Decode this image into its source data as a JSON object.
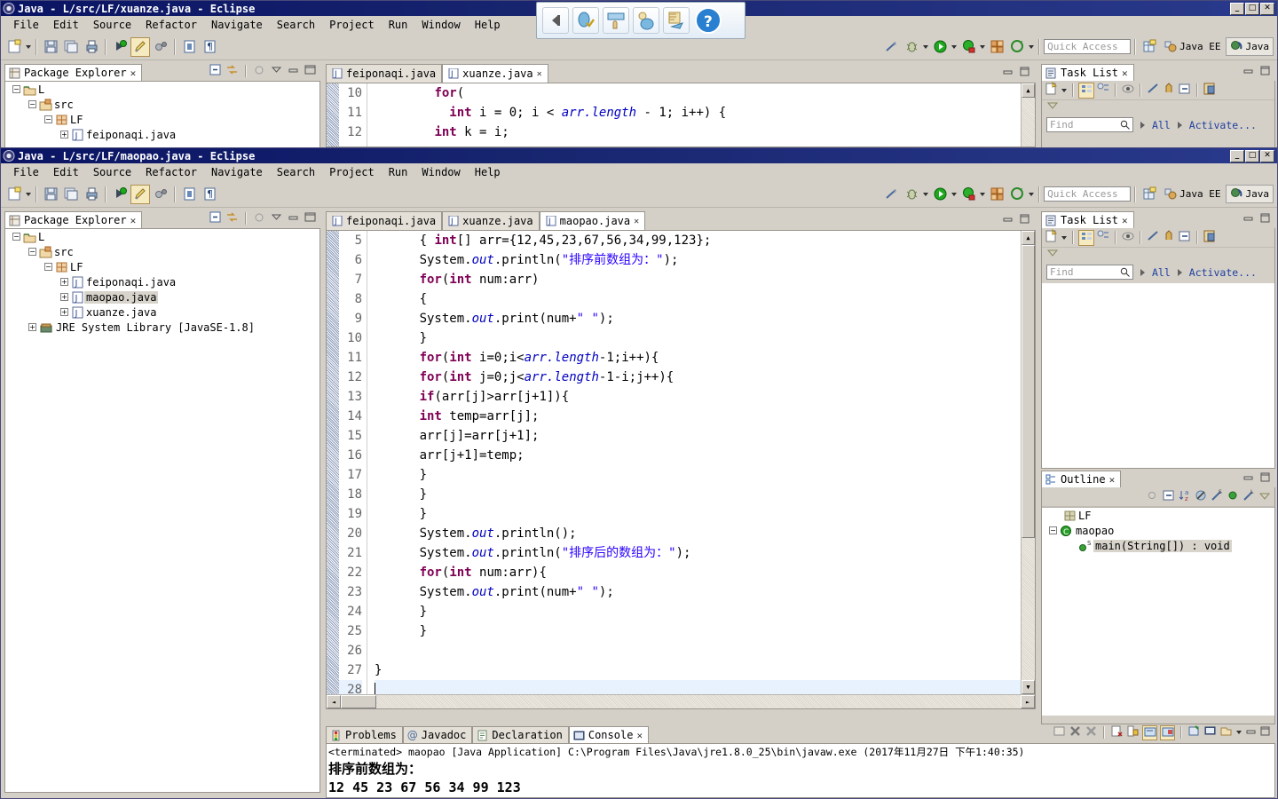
{
  "window_back": {
    "title": "Java - L/src/LF/xuanze.java - Eclipse",
    "menu": [
      "File",
      "Edit",
      "Source",
      "Refactor",
      "Navigate",
      "Search",
      "Project",
      "Run",
      "Window",
      "Help"
    ],
    "quick_access_placeholder": "Quick Access",
    "perspectives": [
      {
        "label": "Java EE"
      },
      {
        "label": "Java"
      }
    ],
    "explorer": {
      "tab_label": "Package Explorer",
      "tree": [
        {
          "label": "L",
          "indent": 0,
          "expander": "-",
          "icon": "project-folder-icon"
        },
        {
          "label": "src",
          "indent": 1,
          "expander": "-",
          "icon": "source-folder-icon"
        },
        {
          "label": "LF",
          "indent": 2,
          "expander": "-",
          "icon": "package-icon"
        },
        {
          "label": "feiponaqi.java",
          "indent": 3,
          "expander": "+",
          "icon": "java-file-icon"
        }
      ]
    },
    "editor": {
      "tabs": [
        {
          "label": "feiponaqi.java",
          "active": false,
          "closable": false
        },
        {
          "label": "xuanze.java",
          "active": true,
          "closable": true
        }
      ],
      "lines": [
        {
          "num": "10",
          "segments": [
            {
              "t": "        ",
              "c": ""
            },
            {
              "t": "for",
              "c": "kw"
            },
            {
              "t": "(",
              "c": ""
            }
          ]
        },
        {
          "num": "11",
          "segments": [
            {
              "t": "          ",
              "c": ""
            },
            {
              "t": "int",
              "c": "kw"
            },
            {
              "t": " i = 0; i < ",
              "c": ""
            },
            {
              "t": "arr.length",
              "c": "fld"
            },
            {
              "t": " - 1; i++) {",
              "c": ""
            }
          ]
        },
        {
          "num": "12",
          "segments": [
            {
              "t": "        ",
              "c": ""
            },
            {
              "t": "int",
              "c": "kw"
            },
            {
              "t": " k = i;",
              "c": ""
            }
          ]
        }
      ]
    },
    "task_list": {
      "tab_label": "Task List",
      "find_placeholder": "Find",
      "all_label": "All",
      "activate_label": "Activate..."
    }
  },
  "window_front": {
    "title": "Java - L/src/LF/maopao.java - Eclipse",
    "menu": [
      "File",
      "Edit",
      "Source",
      "Refactor",
      "Navigate",
      "Search",
      "Project",
      "Run",
      "Window",
      "Help"
    ],
    "quick_access_placeholder": "Quick Access",
    "perspectives": [
      {
        "label": "Java EE"
      },
      {
        "label": "Java"
      }
    ],
    "explorer": {
      "tab_label": "Package Explorer",
      "tree": [
        {
          "label": "L",
          "indent": 0,
          "expander": "-",
          "icon": "project-folder-icon",
          "selected": false
        },
        {
          "label": "src",
          "indent": 1,
          "expander": "-",
          "icon": "source-folder-icon",
          "selected": false
        },
        {
          "label": "LF",
          "indent": 2,
          "expander": "-",
          "icon": "package-icon",
          "selected": false
        },
        {
          "label": "feiponaqi.java",
          "indent": 3,
          "expander": "+",
          "icon": "java-file-icon",
          "selected": false
        },
        {
          "label": "maopao.java",
          "indent": 3,
          "expander": "+",
          "icon": "java-file-icon",
          "selected": true
        },
        {
          "label": "xuanze.java",
          "indent": 3,
          "expander": "+",
          "icon": "java-file-icon",
          "selected": false
        },
        {
          "label": "JRE System Library  [JavaSE-1.8]",
          "indent": 1,
          "expander": "+",
          "icon": "jre-library-icon",
          "selected": false
        }
      ]
    },
    "editor": {
      "tabs": [
        {
          "label": "feiponaqi.java",
          "active": false,
          "closable": false
        },
        {
          "label": "xuanze.java",
          "active": false,
          "closable": false
        },
        {
          "label": "maopao.java",
          "active": true,
          "closable": true
        }
      ],
      "lines": [
        {
          "num": "5",
          "segments": [
            {
              "t": "      { ",
              "c": ""
            },
            {
              "t": "int",
              "c": "kw"
            },
            {
              "t": "[] arr={12,45,23,67,56,34,99,123};",
              "c": ""
            }
          ]
        },
        {
          "num": "6",
          "segments": [
            {
              "t": "      System.",
              "c": ""
            },
            {
              "t": "out",
              "c": "fld"
            },
            {
              "t": ".println(",
              "c": ""
            },
            {
              "t": "\"排序前数组为：\"",
              "c": "str"
            },
            {
              "t": ");",
              "c": ""
            }
          ]
        },
        {
          "num": "7",
          "segments": [
            {
              "t": "      ",
              "c": ""
            },
            {
              "t": "for",
              "c": "kw"
            },
            {
              "t": "(",
              "c": ""
            },
            {
              "t": "int",
              "c": "kw"
            },
            {
              "t": " num:arr)",
              "c": ""
            }
          ]
        },
        {
          "num": "8",
          "segments": [
            {
              "t": "      {",
              "c": ""
            }
          ]
        },
        {
          "num": "9",
          "segments": [
            {
              "t": "      System.",
              "c": ""
            },
            {
              "t": "out",
              "c": "fld"
            },
            {
              "t": ".print(num+",
              "c": ""
            },
            {
              "t": "\" \"",
              "c": "str"
            },
            {
              "t": ");",
              "c": ""
            }
          ]
        },
        {
          "num": "10",
          "segments": [
            {
              "t": "      }",
              "c": ""
            }
          ]
        },
        {
          "num": "11",
          "segments": [
            {
              "t": "      ",
              "c": ""
            },
            {
              "t": "for",
              "c": "kw"
            },
            {
              "t": "(",
              "c": ""
            },
            {
              "t": "int",
              "c": "kw"
            },
            {
              "t": " i=0;i<",
              "c": ""
            },
            {
              "t": "arr.length",
              "c": "fld"
            },
            {
              "t": "-1;i++){",
              "c": ""
            }
          ]
        },
        {
          "num": "12",
          "segments": [
            {
              "t": "      ",
              "c": ""
            },
            {
              "t": "for",
              "c": "kw"
            },
            {
              "t": "(",
              "c": ""
            },
            {
              "t": "int",
              "c": "kw"
            },
            {
              "t": " j=0;j<",
              "c": ""
            },
            {
              "t": "arr.length",
              "c": "fld"
            },
            {
              "t": "-1-i;j++){",
              "c": ""
            }
          ]
        },
        {
          "num": "13",
          "segments": [
            {
              "t": "      ",
              "c": ""
            },
            {
              "t": "if",
              "c": "kw"
            },
            {
              "t": "(arr[j]>arr[j+1]){",
              "c": ""
            }
          ]
        },
        {
          "num": "14",
          "segments": [
            {
              "t": "      ",
              "c": ""
            },
            {
              "t": "int",
              "c": "kw"
            },
            {
              "t": " temp=arr[j];",
              "c": ""
            }
          ]
        },
        {
          "num": "15",
          "segments": [
            {
              "t": "      arr[j]=arr[j+1];",
              "c": ""
            }
          ]
        },
        {
          "num": "16",
          "segments": [
            {
              "t": "      arr[j+1]=temp;",
              "c": ""
            }
          ]
        },
        {
          "num": "17",
          "segments": [
            {
              "t": "      }",
              "c": ""
            }
          ]
        },
        {
          "num": "18",
          "segments": [
            {
              "t": "      }",
              "c": ""
            }
          ]
        },
        {
          "num": "19",
          "segments": [
            {
              "t": "      }",
              "c": ""
            }
          ]
        },
        {
          "num": "20",
          "segments": [
            {
              "t": "      System.",
              "c": ""
            },
            {
              "t": "out",
              "c": "fld"
            },
            {
              "t": ".println();",
              "c": ""
            }
          ]
        },
        {
          "num": "21",
          "segments": [
            {
              "t": "      System.",
              "c": ""
            },
            {
              "t": "out",
              "c": "fld"
            },
            {
              "t": ".println(",
              "c": ""
            },
            {
              "t": "\"排序后的数组为：\"",
              "c": "str"
            },
            {
              "t": ");",
              "c": ""
            }
          ]
        },
        {
          "num": "22",
          "segments": [
            {
              "t": "      ",
              "c": ""
            },
            {
              "t": "for",
              "c": "kw"
            },
            {
              "t": "(",
              "c": ""
            },
            {
              "t": "int",
              "c": "kw"
            },
            {
              "t": " num:arr){",
              "c": ""
            }
          ]
        },
        {
          "num": "23",
          "segments": [
            {
              "t": "      System.",
              "c": ""
            },
            {
              "t": "out",
              "c": "fld"
            },
            {
              "t": ".print(num+",
              "c": ""
            },
            {
              "t": "\" \"",
              "c": "str"
            },
            {
              "t": ");",
              "c": ""
            }
          ]
        },
        {
          "num": "24",
          "segments": [
            {
              "t": "      }",
              "c": ""
            }
          ]
        },
        {
          "num": "25",
          "segments": [
            {
              "t": "      }",
              "c": ""
            }
          ]
        },
        {
          "num": "26",
          "segments": [
            {
              "t": "",
              "c": ""
            }
          ]
        },
        {
          "num": "27",
          "segments": [
            {
              "t": "}",
              "c": ""
            }
          ]
        },
        {
          "num": "28",
          "segments": [
            {
              "t": "",
              "c": ""
            }
          ],
          "caret": true
        }
      ]
    },
    "task_list": {
      "tab_label": "Task List",
      "find_placeholder": "Find",
      "all_label": "All",
      "activate_label": "Activate..."
    },
    "outline": {
      "tab_label": "Outline",
      "tree": [
        {
          "label": "LF",
          "indent": 1,
          "expander": "",
          "icon": "package-icon",
          "selected": false
        },
        {
          "label": "maopao",
          "indent": 0,
          "expander": "-",
          "icon": "class-icon",
          "selected": false
        },
        {
          "label": "main(String[]) : void",
          "indent": 2,
          "expander": "",
          "icon": "method-public-static-icon",
          "selected": true
        }
      ]
    },
    "bottom_panel": {
      "tabs": [
        {
          "label": "Problems",
          "icon": "problems-icon",
          "active": false
        },
        {
          "label": "Javadoc",
          "icon": "javadoc-icon",
          "active": false
        },
        {
          "label": "Declaration",
          "icon": "declaration-icon",
          "active": false
        },
        {
          "label": "Console",
          "icon": "console-icon",
          "active": true
        }
      ],
      "console": {
        "header": "<terminated> maopao [Java Application] C:\\Program Files\\Java\\jre1.8.0_25\\bin\\javaw.exe (2017年11月27日 下午1:40:35)",
        "lines": [
          "排序前数组为：",
          "12 45 23 67 56 34 99 123"
        ]
      }
    }
  },
  "floating_toolbar": {
    "buttons": [
      {
        "name": "back-arrow-icon"
      },
      {
        "name": "capture-check-icon"
      },
      {
        "name": "hand-capture-icon"
      },
      {
        "name": "region-capture-icon"
      },
      {
        "name": "send-capture-icon"
      },
      {
        "name": "help-icon"
      }
    ]
  },
  "window_controls": {
    "minimize": "_",
    "maximize": "□",
    "close": "✕"
  }
}
